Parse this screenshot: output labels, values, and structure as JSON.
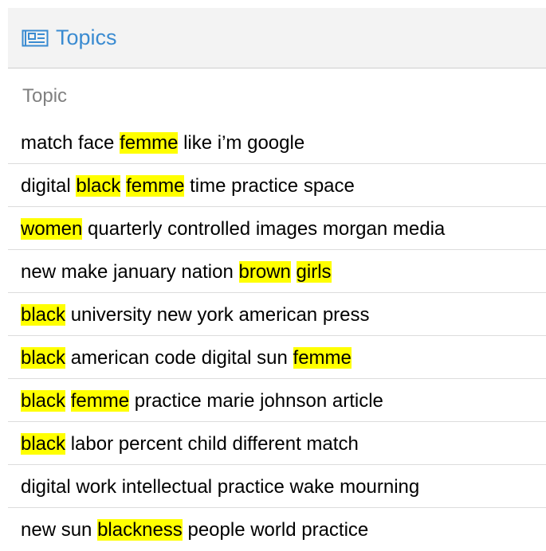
{
  "panel": {
    "title": "Topics",
    "icon": "newspaper-icon",
    "accent_color": "#3a8bd1",
    "highlight_color": "#ffff00"
  },
  "table": {
    "column_header": "Topic",
    "rows": [
      {
        "segments": [
          {
            "text": "match face ",
            "hl": false
          },
          {
            "text": "femme",
            "hl": true
          },
          {
            "text": " like i’m google",
            "hl": false
          }
        ]
      },
      {
        "segments": [
          {
            "text": "digital ",
            "hl": false
          },
          {
            "text": "black",
            "hl": true
          },
          {
            "text": " ",
            "hl": false
          },
          {
            "text": "femme",
            "hl": true
          },
          {
            "text": " time practice space",
            "hl": false
          }
        ]
      },
      {
        "segments": [
          {
            "text": "women",
            "hl": true
          },
          {
            "text": " quarterly controlled images morgan media",
            "hl": false
          }
        ]
      },
      {
        "segments": [
          {
            "text": "new make january nation ",
            "hl": false
          },
          {
            "text": "brown",
            "hl": true
          },
          {
            "text": " ",
            "hl": false
          },
          {
            "text": "girls ",
            "hl": true
          }
        ]
      },
      {
        "segments": [
          {
            "text": "black",
            "hl": true
          },
          {
            "text": " university new york american press",
            "hl": false
          }
        ]
      },
      {
        "segments": [
          {
            "text": "black",
            "hl": true
          },
          {
            "text": " american code digital sun ",
            "hl": false
          },
          {
            "text": "femme",
            "hl": true
          }
        ]
      },
      {
        "segments": [
          {
            "text": "black",
            "hl": true
          },
          {
            "text": " ",
            "hl": false
          },
          {
            "text": "femme",
            "hl": true
          },
          {
            "text": " practice marie johnson article",
            "hl": false
          }
        ]
      },
      {
        "segments": [
          {
            "text": "black",
            "hl": true
          },
          {
            "text": " labor percent child different match",
            "hl": false
          }
        ]
      },
      {
        "segments": [
          {
            "text": "digital work intellectual practice wake mourning",
            "hl": false
          }
        ]
      },
      {
        "segments": [
          {
            "text": "new sun ",
            "hl": false
          },
          {
            "text": "blackness",
            "hl": true
          },
          {
            "text": " people world practice",
            "hl": false
          }
        ]
      }
    ]
  }
}
